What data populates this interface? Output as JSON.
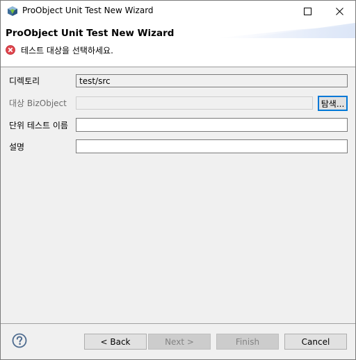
{
  "window": {
    "title": "ProObject Unit Test New Wizard",
    "icon": "proobject-cube-icon",
    "controls": {
      "maximize": "maximize-icon",
      "close": "close-icon"
    }
  },
  "header": {
    "title": "ProObject Unit Test New Wizard",
    "message_icon": "error-icon",
    "message": "테스트 대상을 선택하세요."
  },
  "form": {
    "directory": {
      "label": "디렉토리",
      "value": "test/src",
      "state": "read-only"
    },
    "target_bizobject": {
      "label": "대상 BizObject",
      "value": "",
      "state": "disabled",
      "browse_label": "탐색..."
    },
    "unit_test_name": {
      "label": "단위 테스트 이름",
      "value": ""
    },
    "description": {
      "label": "설명",
      "value": ""
    }
  },
  "footer": {
    "help_icon": "help-icon",
    "buttons": {
      "back": {
        "label": "< Back",
        "enabled": true
      },
      "next": {
        "label": "Next >",
        "enabled": false
      },
      "finish": {
        "label": "Finish",
        "enabled": false
      },
      "cancel": {
        "label": "Cancel",
        "enabled": true
      }
    }
  },
  "colors": {
    "focus_border": "#0078d7",
    "error_red": "#e0454d",
    "dialog_bg": "#f0f0f0"
  }
}
